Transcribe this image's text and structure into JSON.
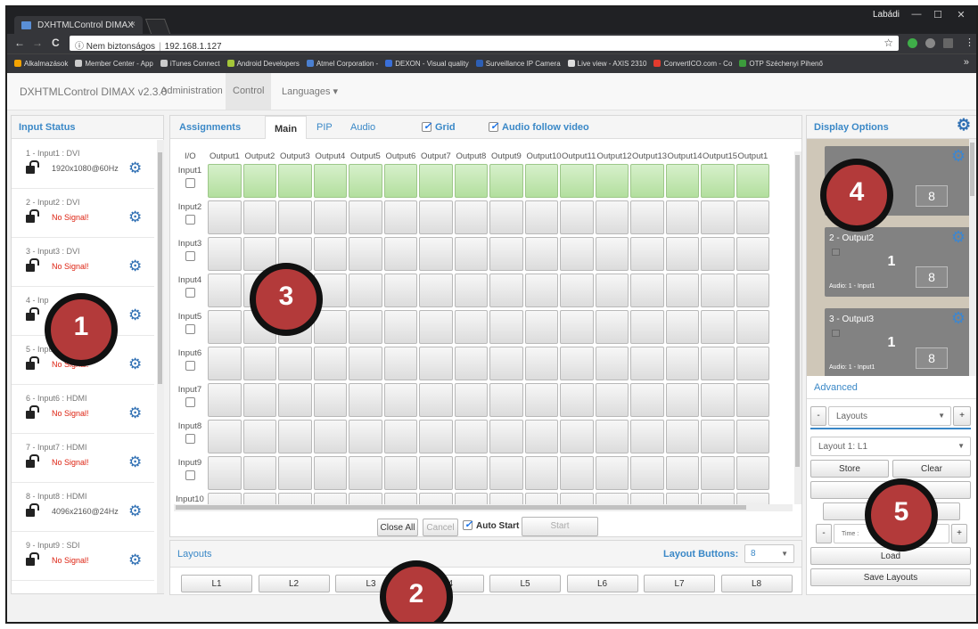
{
  "browser": {
    "tab_title": "DXHTMLControl DIMAX",
    "tab_close": "×",
    "user_label": "Labádi",
    "window_buttons": [
      "—",
      "☐",
      "✕"
    ],
    "nav_back": "←",
    "nav_forward": "→",
    "nav_reload": "C",
    "url_security": "Nem biztonságos",
    "url_text": "192.168.1.127",
    "url_star": "☆",
    "bookmarks": [
      "Alkalmazások",
      "Member Center - App",
      "iTunes Connect",
      "Android Developers",
      "Atmel Corporation - ",
      "DEXON - Visual quality",
      "Surveillance IP Camera",
      "Live view - AXIS 2310",
      "ConvertICO.com - Co",
      "OTP Széchenyi Pihenő"
    ],
    "bookmarks_more": "»",
    "bookmark_colors": [
      "#f4a300",
      "#cccccc",
      "#cccccc",
      "#a4c639",
      "#4a7fd0",
      "#3a6fd8",
      "#2d5fb5",
      "#dddddd",
      "#e33b2e",
      "#3c9c3c"
    ]
  },
  "app_nav": {
    "brand": "DXHTMLControl DIMAX v2.3.0",
    "items": [
      "Administration",
      "Control",
      "Languages ▾"
    ]
  },
  "input_status": {
    "title": "Input Status",
    "items": [
      {
        "label": "1 - Input1 : DVI",
        "value": "1920x1080@60Hz",
        "signal": true
      },
      {
        "label": "2 - Input2 : DVI",
        "value": "No Signal!",
        "signal": false
      },
      {
        "label": "3 - Input3 : DVI",
        "value": "No Signal!",
        "signal": false
      },
      {
        "label": "4 - Inp",
        "value": "",
        "signal": false
      },
      {
        "label": "5 - Input5",
        "value": "No Signal!",
        "signal": false
      },
      {
        "label": "6 - Input6 : HDMI",
        "value": "No Signal!",
        "signal": false
      },
      {
        "label": "7 - Input7 : HDMI",
        "value": "No Signal!",
        "signal": false
      },
      {
        "label": "8 - Input8 : HDMI",
        "value": "4096x2160@24Hz",
        "signal": true
      },
      {
        "label": "9 - Input9 : SDI",
        "value": "No Signal!",
        "signal": false
      }
    ]
  },
  "assignments": {
    "title": "Assignments",
    "tabs": [
      "Main",
      "PIP",
      "Audio"
    ],
    "grid_label": "Grid",
    "audio_follow_label": "Audio follow video",
    "corner_label": "I/O",
    "outputs": [
      "Output1",
      "Output2",
      "Output3",
      "Output4",
      "Output5",
      "Output6",
      "Output7",
      "Output8",
      "Output9",
      "Output10",
      "Output11",
      "Output12",
      "Output13",
      "Output14",
      "Output15",
      "Output1"
    ],
    "inputs": [
      "Input1",
      "Input2",
      "Input3",
      "Input4",
      "Input5",
      "Input6",
      "Input7",
      "Input8",
      "Input9",
      "Input10"
    ],
    "active_row": 0,
    "close_all_label": "Close All",
    "cancel_label": "Cancel",
    "auto_start_label": "Auto Start",
    "start_label": "Start"
  },
  "layouts_bar": {
    "title": "Layouts",
    "buttons_label": "Layout Buttons:",
    "buttons_value": "8",
    "buttons": [
      "L1",
      "L2",
      "L3",
      "L4",
      "L5",
      "L6",
      "L7",
      "L8"
    ]
  },
  "display_options": {
    "title": "Display Options",
    "cards": [
      {
        "name": "",
        "big": "",
        "box": "8",
        "audio": ""
      },
      {
        "name": "2 - Output2",
        "big": "1",
        "box": "8",
        "audio": "Audio: 1 - Input1"
      },
      {
        "name": "3 - Output3",
        "big": "1",
        "box": "8",
        "audio": "Audio: 1 - Input1"
      }
    ]
  },
  "advanced": {
    "title": "Advanced",
    "minus": "-",
    "plus": "+",
    "layouts_select": "Layouts",
    "layout_select": "Layout 1: L1",
    "store_label": "Store",
    "clear_label": "Clear",
    "rename_label": "Ren",
    "time_label": "Time :",
    "load_label": "Load",
    "save_label": "Save Layouts"
  },
  "markers": [
    "1",
    "2",
    "3",
    "4",
    "5"
  ]
}
